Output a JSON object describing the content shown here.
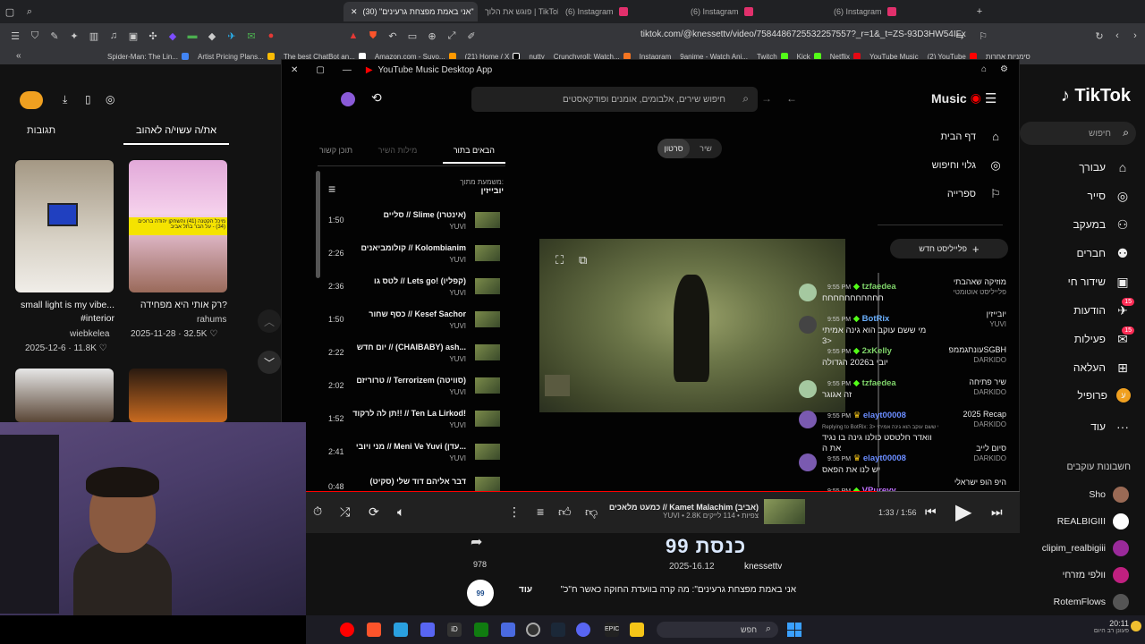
{
  "browser": {
    "tabs": [
      {
        "label": "(30) \"אני באמת מפצחת גרעינים\"",
        "active": true
      },
      {
        "label": "פוגש את הלוך | TikTok"
      },
      {
        "label": "(6) Instagram"
      },
      {
        "label": "(6) Instagram"
      },
      {
        "label": "(6) Instagram"
      }
    ],
    "url": "tiktok.com/@knessettv/video/7584486725532257557?_r=1&_t=ZS-93D3HW54IFx",
    "bookmarks": [
      "Spider-Man: The Lin...",
      "Artist Pricing Plans...",
      "The best ChatBot an...",
      "Amazon.com - Suvo...",
      "(21) Home / X",
      "nutty",
      "Crunchyroll: Watch...",
      "Instagram",
      "9anime - Watch Ani...",
      "Twitch",
      "Kick",
      "Netflix",
      "YouTube Music",
      "(2) YouTube",
      "סימניות אחרות"
    ]
  },
  "tiktok": {
    "logo": "TikTok",
    "search_placeholder": "חיפוש",
    "tabs": [
      "תגובות",
      "את/ה עשוי/ה לאהוב"
    ],
    "nav": [
      {
        "label": "עבורך",
        "icon": "home-icon"
      },
      {
        "label": "סייר",
        "icon": "compass-icon"
      },
      {
        "label": "במעקב",
        "icon": "user-plus-icon"
      },
      {
        "label": "חברים",
        "icon": "friends-icon"
      },
      {
        "label": "שידור חי",
        "icon": "live-icon"
      },
      {
        "label": "הודעות",
        "icon": "message-icon",
        "badge": "15"
      },
      {
        "label": "פעילות",
        "icon": "activity-icon",
        "badge": "15"
      },
      {
        "label": "העלאה",
        "icon": "upload-icon"
      },
      {
        "label": "פרופיל",
        "icon": "profile-icon"
      },
      {
        "label": "עוד",
        "icon": "more-icon"
      }
    ],
    "following_header": "חשבונות עוקבים",
    "following": [
      "Sho",
      "REALBIGIII",
      "clipim_realbigiii",
      "וולפי מזרחי",
      "RotemFlows"
    ],
    "cards": [
      {
        "caption": "small light is my vibe... #interior",
        "author": "wiebkelea",
        "date": "2025-12-6",
        "likes": "11.8K"
      },
      {
        "caption": "רק אותי היא מפחידה?",
        "author": "rahums",
        "date": "2025-11-28",
        "likes": "32.5K"
      }
    ],
    "card_overlay": "מיכל הקטנה (41) והשחקן יהודה ברוכים (34) - על הבר בתל אביב",
    "video": {
      "likes": "978",
      "channel_overlay": "כנסת 99",
      "date_overlay": "2025-16.12",
      "author": "knessettv",
      "description": "\"אני באמת מפצחת גרעינים\": מה קרה בוועדת החוקה כאשר ח\"כ",
      "more": "עוד"
    }
  },
  "ytmusic": {
    "window_title": "YouTube Music Desktop App",
    "brand": "Music",
    "search_placeholder": "חיפוש שירים, אלבומים, אומנים ופודקאסטים",
    "nav": [
      {
        "label": "דף הבית",
        "icon": "home-icon"
      },
      {
        "label": "גלוי וחיפוש",
        "icon": "explore-icon"
      },
      {
        "label": "ספרייה",
        "icon": "library-icon"
      }
    ],
    "new_playlist": "פלייליסט חדש",
    "playlists": [
      {
        "title": "מוזיקה שאהבתי",
        "sub": "פלייליסט אוטומטי"
      },
      {
        "title": "יובייזין",
        "sub": "YUVI"
      },
      {
        "title": "עונתגממפSGBH",
        "sub": "DARKIDO"
      },
      {
        "title": "שיר פתיחה",
        "sub": "DARKIDO"
      },
      {
        "title": "2025 Recap",
        "sub": "DARKIDO"
      },
      {
        "title": "סיום לייב",
        "sub": "DARKIDO"
      },
      {
        "title": "היפ הופ ישראלי",
        "sub": ""
      }
    ],
    "toggle": {
      "song": "שיר",
      "video": "סרטון"
    },
    "queue_tabs": [
      "הבאים בתור",
      "מילות השיר",
      "תוכן קשור"
    ],
    "playing_from_label": "משמעת מתוך:",
    "playing_from": "יובייזין",
    "queue": [
      {
        "title": "סליים // Slime (אינטרו)",
        "artist": "YUVI",
        "duration": "1:50"
      },
      {
        "title": "קולומביאנים // Kolombianim",
        "artist": "YUVI",
        "duration": "2:26"
      },
      {
        "title": "לטס גו // Lets go! (קפליו)",
        "artist": "YUVI",
        "duration": "2:36"
      },
      {
        "title": "כסף שחור // Kesef Sachor",
        "artist": "YUVI",
        "duration": "1:50"
      },
      {
        "title": "יום חדש // (CHAIBABY) ash...",
        "artist": "YUVI",
        "duration": "2:22"
      },
      {
        "title": "טרוריזם // Terrorizem (סוויטה)",
        "artist": "YUVI",
        "duration": "2:02"
      },
      {
        "title": "תן לה לרקוד!! // Ten La Lirkod!",
        "artist": "YUVI",
        "duration": "1:52"
      },
      {
        "title": "מני ויובי // Meni Ve Yuvi (עדן...",
        "artist": "YUVI",
        "duration": "2:41"
      },
      {
        "title": "דבר אליהם דוד שלי (סקיט)",
        "artist": "",
        "duration": "0:48"
      }
    ],
    "now_playing": {
      "title": "כמעט מלאכים // Kamet Malachim (אביב)",
      "meta": "YUVI • 2.8K צפיות • 114 לייקים",
      "time": "1:33 / 1:56",
      "progress": 0.8
    }
  },
  "chat": [
    {
      "name": "tzfaedea",
      "time": "9:55 PM",
      "color": "#7fd46a",
      "text": "חחחחחחחחחחח"
    },
    {
      "name": "BotRix",
      "time": "9:55 PM",
      "color": "#6ab0ff",
      "text": "מי ששם עוקב הוא גינה אמיתי <3"
    },
    {
      "name": "2xKelly",
      "time": "9:55 PM",
      "color": "#7fd46a",
      "text": "יובי ב2026 הגדולה"
    },
    {
      "name": "tzfaedea",
      "time": "9:55 PM",
      "color": "#7fd46a",
      "text": "זה אגוגר"
    },
    {
      "name": "elayt00008",
      "time": "9:55 PM",
      "color": "#6a8cff",
      "reply": "Replying to BotRix: מי ששם עוקב הוא גינה אמיתי <3",
      "text": "וואדר חלטסט כולנו גינה בו נגיד את ה"
    },
    {
      "name": "elayt00008",
      "time": "9:55 PM",
      "color": "#6a8cff",
      "text": "יש לנו את הפאס"
    },
    {
      "name": "VPureyy",
      "time": "9:55 PM",
      "color": "#c070ff",
      "text": ""
    },
    {
      "name": "VPureyy",
      "time": "9:55 PM",
      "color": "#c070ff",
      "text": ""
    }
  ],
  "taskbar": {
    "search_placeholder": "חפש",
    "clock": "20:11",
    "weather": "פעונן רב היום"
  }
}
